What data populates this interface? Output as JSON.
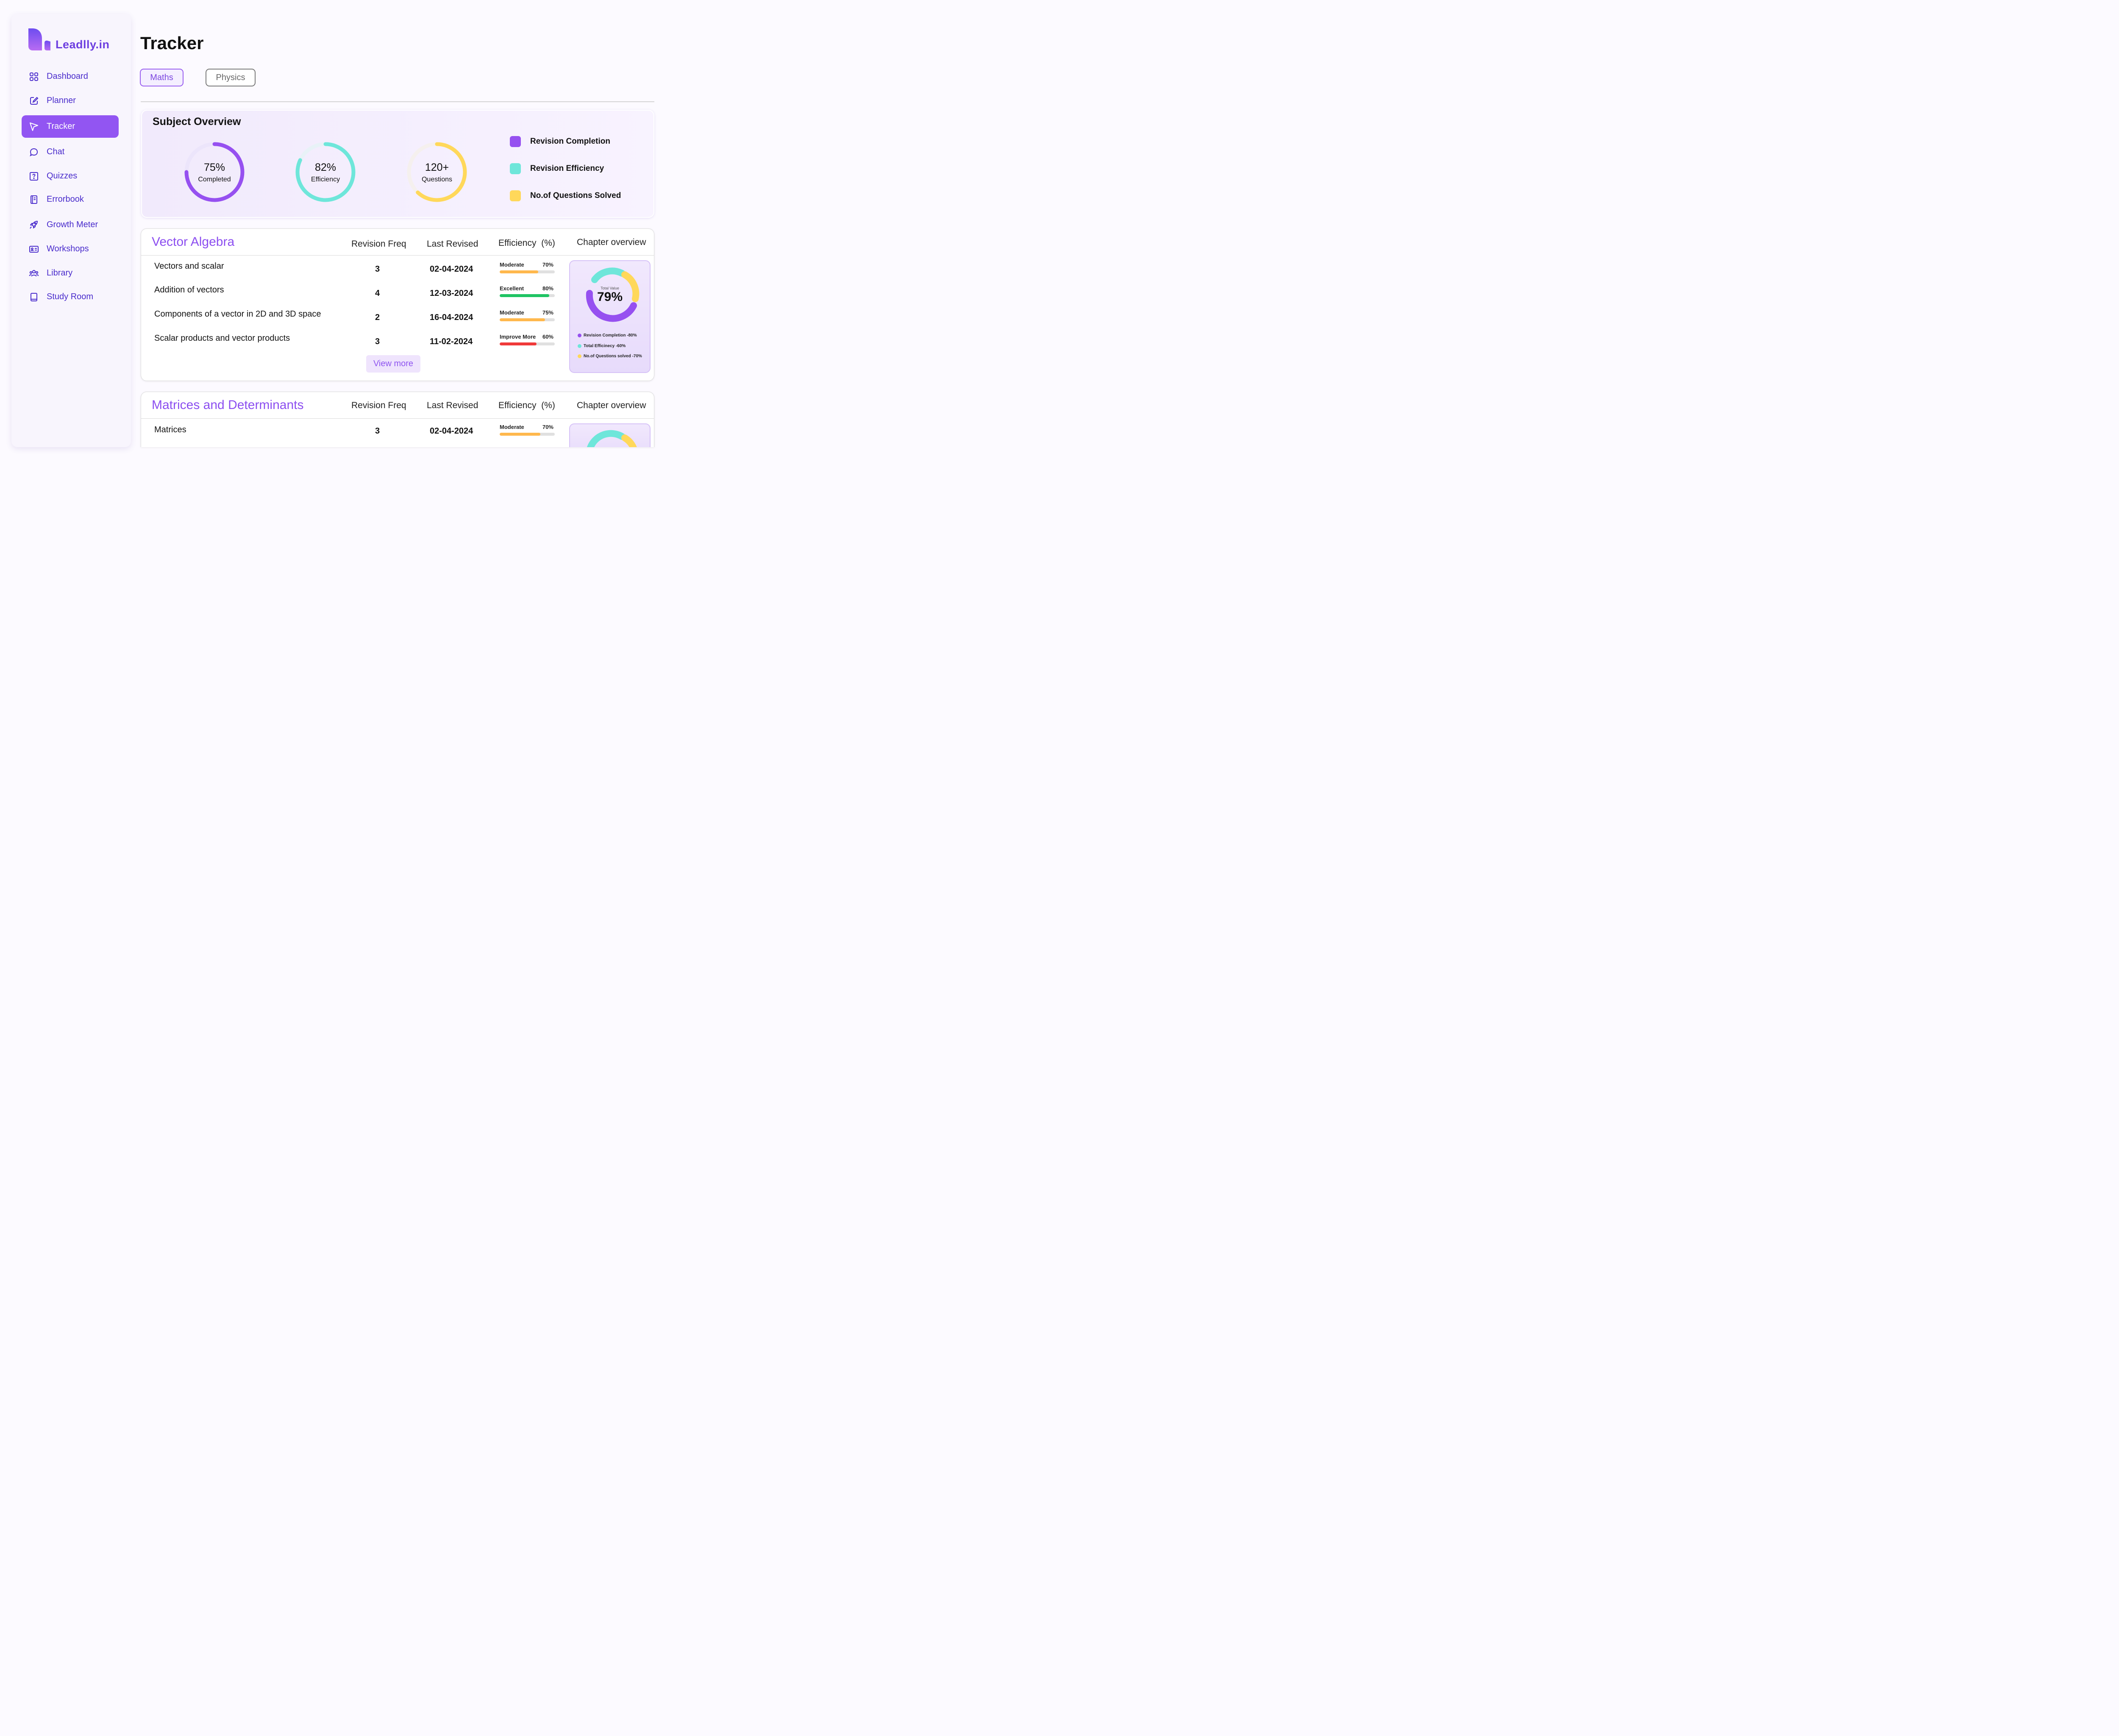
{
  "brand": {
    "name": "Leadlly.in"
  },
  "sidebar": {
    "items": [
      {
        "label": "Dashboard",
        "icon": "grid-icon"
      },
      {
        "label": "Planner",
        "icon": "edit-icon"
      },
      {
        "label": "Tracker",
        "icon": "cursor-icon",
        "active": true
      },
      {
        "label": "Chat",
        "icon": "chat-icon"
      },
      {
        "label": "Quizzes",
        "icon": "question-icon"
      },
      {
        "label": "Errorbook",
        "icon": "book-icon"
      },
      {
        "label": "Growth Meter",
        "icon": "rocket-icon"
      },
      {
        "label": "Workshops",
        "icon": "id-card-icon"
      },
      {
        "label": "Library",
        "icon": "users-icon"
      },
      {
        "label": "Study Room",
        "icon": "tablet-icon"
      }
    ]
  },
  "header": {
    "title": "Tracker"
  },
  "tabs": [
    {
      "label": "Maths",
      "active": true
    },
    {
      "label": "Physics",
      "active": false
    }
  ],
  "overview": {
    "title": "Subject Overview",
    "rings": [
      {
        "value": "75%",
        "caption": "Completed",
        "percent": 75,
        "color": "#9650f0",
        "track": "#ece5fb"
      },
      {
        "value": "82%",
        "caption": "Efficiency",
        "percent": 82,
        "color": "#6ee6da",
        "track": "#e8f2f7"
      },
      {
        "value": "120+",
        "caption": "Questions",
        "percent": 62,
        "color": "#ffd85a",
        "track": "#f5f0ee"
      }
    ],
    "legend": [
      {
        "label": "Revision Completion",
        "color": "#9650f0"
      },
      {
        "label": "Revision Efficiency",
        "color": "#6ee6da"
      },
      {
        "label": "No.of Questions Solved",
        "color": "#ffd85a"
      }
    ]
  },
  "columns": {
    "freq": "Revision Freq",
    "last": "Last Revised",
    "eff": "Efficiency",
    "eff_unit": "(%)",
    "overview": "Chapter overview"
  },
  "chapters": [
    {
      "title": "Vector Algebra",
      "topics": [
        {
          "name": "Vectors and scalar",
          "freq": "3",
          "date": "02-04-2024",
          "status": "Moderate",
          "pct_label": "70%",
          "pct": 70,
          "color": "#ffb84d"
        },
        {
          "name": "Addition of vectors",
          "freq": "4",
          "date": "12-03-2024",
          "status": "Excellent",
          "pct_label": "80%",
          "pct": 90,
          "color": "#1fc463"
        },
        {
          "name": "Components of a vector  in 2D and 3D space",
          "freq": "2",
          "date": "16-04-2024",
          "status": "Moderate",
          "pct_label": "75%",
          "pct": 82,
          "color": "#ffb84d"
        },
        {
          "name": "Scalar products and vector products",
          "freq": "3",
          "date": "11-02-2024",
          "status": "Improve More",
          "pct_label": "60%",
          "pct": 67,
          "color": "#f03a3a"
        }
      ],
      "view_more": "View more",
      "card": {
        "total_label": "Total Value",
        "total_value": "79%",
        "legend": [
          {
            "label": "Revision Completion",
            "value": "-80%",
            "color": "#9650f0"
          },
          {
            "label": "Total Efficinecy",
            "value": "-60%",
            "color": "#6ee6da"
          },
          {
            "label": "No.of Questions solved",
            "value": "-70%",
            "color": "#ffd85a"
          }
        ]
      }
    },
    {
      "title": "Matrices and Determinants",
      "topics": [
        {
          "name": "Matrices",
          "freq": "3",
          "date": "02-04-2024",
          "status": "Moderate",
          "pct_label": "70%",
          "pct": 74,
          "color": "#ffb84d"
        }
      ]
    }
  ]
}
